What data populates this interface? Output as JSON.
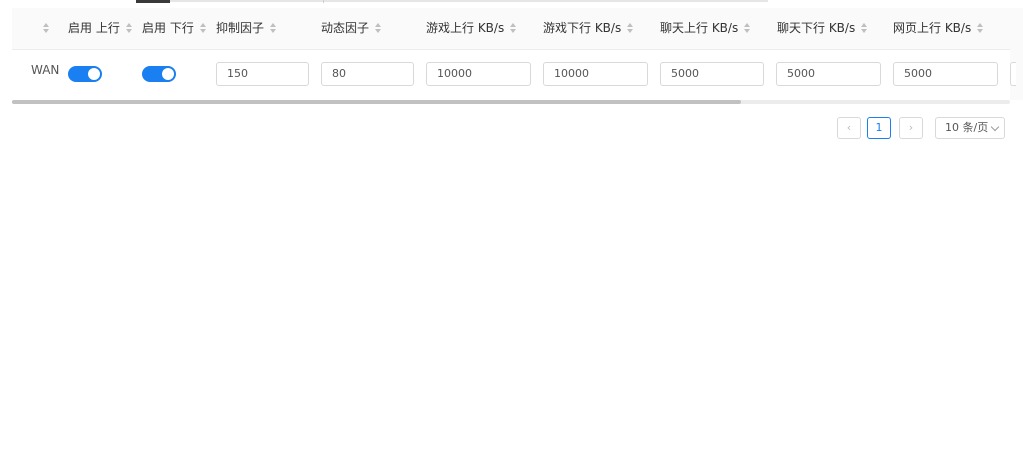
{
  "table": {
    "headers": [
      {
        "label": "",
        "sortable": true
      },
      {
        "label": "启用 上行",
        "sortable": true
      },
      {
        "label": "启用 下行",
        "sortable": true
      },
      {
        "label": "抑制因子",
        "sortable": true
      },
      {
        "label": "动态因子",
        "sortable": true
      },
      {
        "label": "游戏上行 KB/s",
        "sortable": true
      },
      {
        "label": "游戏下行 KB/s",
        "sortable": true
      },
      {
        "label": "聊天上行 KB/s",
        "sortable": true
      },
      {
        "label": "聊天下行 KB/s",
        "sortable": true
      },
      {
        "label": "网页上行 KB/s",
        "sortable": true
      }
    ],
    "rows": [
      {
        "interface": "WAN",
        "enable_up": true,
        "enable_down": true,
        "suppress_factor": "150",
        "dynamic_factor": "80",
        "game_up": "10000",
        "game_down": "10000",
        "chat_up": "5000",
        "chat_down": "5000",
        "web_up": "5000"
      }
    ]
  },
  "scroll": {
    "visible_fraction": 0.73
  },
  "pagination": {
    "prev_icon": "‹",
    "current_page": "1",
    "next_icon": "›",
    "page_size": "10 条/页"
  },
  "colors": {
    "accent": "#1a7ff0",
    "border": "#d9d9d9",
    "header_bg": "#fafafa"
  }
}
